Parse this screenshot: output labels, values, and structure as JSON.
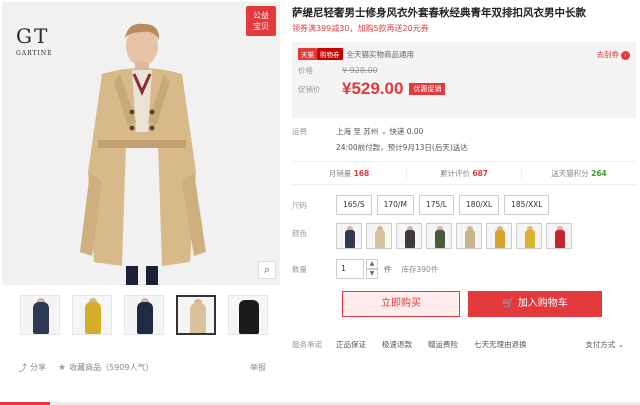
{
  "brand": {
    "mark": "GT",
    "name": "GARTINE"
  },
  "badge": {
    "line1": "公益",
    "line2": "宝贝"
  },
  "thumbnails": [
    {
      "color": "#2e3a52"
    },
    {
      "color": "#d6ac2b"
    },
    {
      "color": "#1f2a44"
    },
    {
      "color": "#d8c39a"
    },
    {
      "color": "#1a1a1a"
    }
  ],
  "share": {
    "share_label": "分享",
    "fav_label": "收藏商品",
    "fav_count": "（5909人气）",
    "report_label": "举报"
  },
  "product": {
    "title": "萨缇尼轻奢男士修身风衣外套春秋经典青年双排扣风衣男中长款",
    "subtitle": "领券满399减30，加购5款再送20元券"
  },
  "promo": {
    "tag_tmall": "天猫",
    "tag_coupon": "购物券",
    "text": "全天猫实物商品通用",
    "more": "去刮券"
  },
  "price": {
    "orig_label": "价格",
    "orig_value": "¥ 928.00",
    "promo_label": "促销价",
    "promo_value": "¥529.00",
    "promo_badge": "优惠促销"
  },
  "shipping": {
    "label": "运费",
    "from": "上海",
    "to": "至 苏州",
    "method": "快递 0.00",
    "eta": "24:00前付款，预计9月13日(后天)送达"
  },
  "stats": {
    "monthly_label": "月销量",
    "monthly_value": "168",
    "reviews_label": "累计评价",
    "reviews_value": "687",
    "points_label": "送天猫积分",
    "points_value": "264"
  },
  "options": {
    "size_label": "尺码",
    "sizes": [
      "165/S",
      "170/M",
      "175/L",
      "180/XL",
      "185/XXL"
    ],
    "color_label": "颜色",
    "colors": [
      "#2e3a52",
      "#d9c29d",
      "#3b3b3b",
      "#4b5a3a",
      "#c8b48a",
      "#d7a72b",
      "#d9b22e",
      "#c0262d"
    ],
    "qty_label": "数量",
    "qty_value": "1",
    "qty_unit": "件",
    "stock": "库存390件"
  },
  "actions": {
    "buy": "立即购买",
    "cart": "加入购物车"
  },
  "service": {
    "label": "服务承诺",
    "items": [
      "正品保证",
      "极速退款",
      "赠运费险",
      "七天无理由退换"
    ],
    "pay": "支付方式"
  }
}
